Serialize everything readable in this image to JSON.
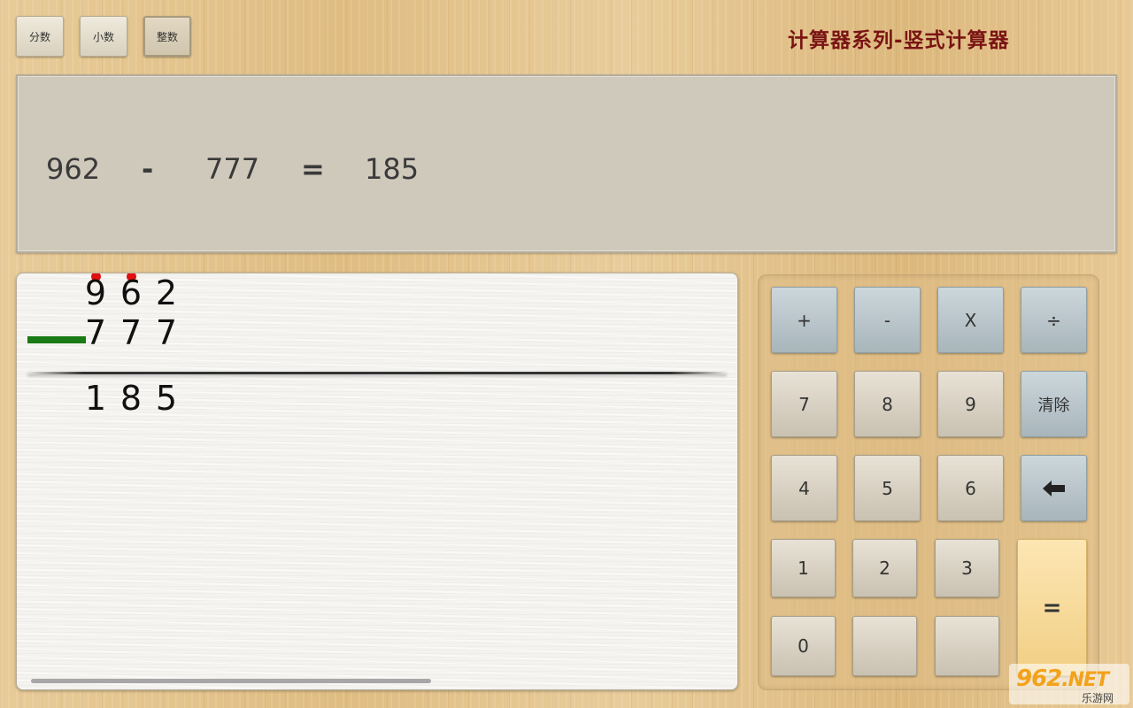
{
  "mode_buttons": {
    "fraction": "分数",
    "decimal": "小数",
    "integer": "整数"
  },
  "title": "计算器系列-竖式计算器",
  "display": {
    "operand1": "962",
    "operator": "-",
    "operand2": "777",
    "equals": "=",
    "result": "185"
  },
  "vertical": {
    "minuend": [
      "9",
      "6",
      "2"
    ],
    "subtrahend": [
      "7",
      "7",
      "7"
    ],
    "result": [
      "1",
      "8",
      "5"
    ],
    "borrow_digits": [
      0,
      1
    ]
  },
  "keys": {
    "plus": "+",
    "minus": "-",
    "times": "X",
    "divide": "÷",
    "k7": "7",
    "k8": "8",
    "k9": "9",
    "clear": "清除",
    "k4": "4",
    "k5": "5",
    "k6": "6",
    "k1": "1",
    "k2": "2",
    "k3": "3",
    "k0": "0",
    "equals": "="
  },
  "watermark": {
    "logo_main": "962",
    "logo_suffix": ".NET",
    "sub": "乐游网"
  },
  "colors": {
    "title": "#7a1414",
    "borrow_dot": "#e01010",
    "minus_bar": "#1a7a14",
    "op_key": "#b9c5ca",
    "equals_key": "#f6d995"
  },
  "icons": {
    "backspace": "arrow-left-icon"
  }
}
